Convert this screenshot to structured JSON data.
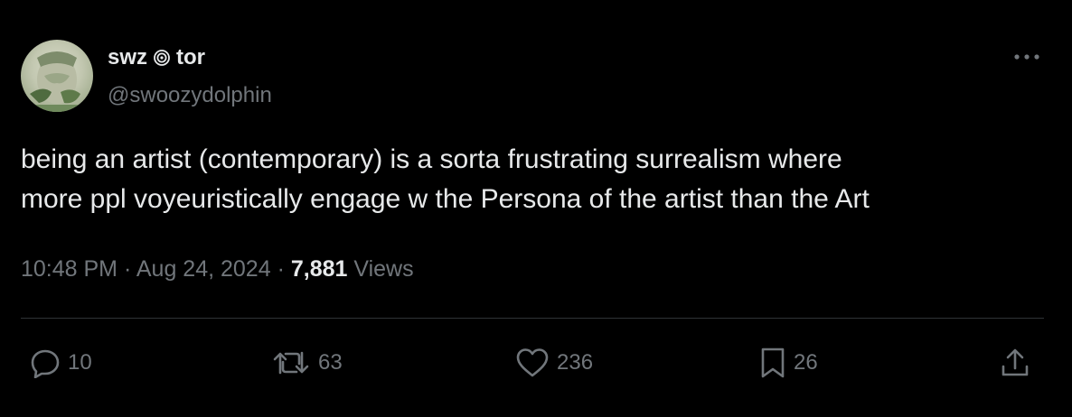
{
  "author": {
    "display_name_left": "swz",
    "display_name_right": "tor",
    "handle": "@swoozydolphin",
    "name_icon": "spiral-icon",
    "avatar_icon": "avatar"
  },
  "tweet": {
    "text_line1": "being an artist (contemporary) is a sorta frustrating surrealism where",
    "text_line2": "more ppl voyeuristically engage w the Persona of the artist than the Art",
    "time": "10:48 PM",
    "separator": "·",
    "date": "Aug 24, 2024",
    "views_count": "7,881",
    "views_label": "Views"
  },
  "actions": {
    "reply_count": "10",
    "retweet_count": "63",
    "like_count": "236",
    "bookmark_count": "26",
    "reply_icon": "reply-icon",
    "retweet_icon": "retweet-icon",
    "like_icon": "heart-icon",
    "bookmark_icon": "bookmark-icon",
    "share_icon": "share-icon"
  },
  "more_icon": "more-icon",
  "colors": {
    "background": "#000000",
    "text_primary": "#e7e9ea",
    "text_secondary": "#71767b",
    "divider": "#2f3336"
  }
}
